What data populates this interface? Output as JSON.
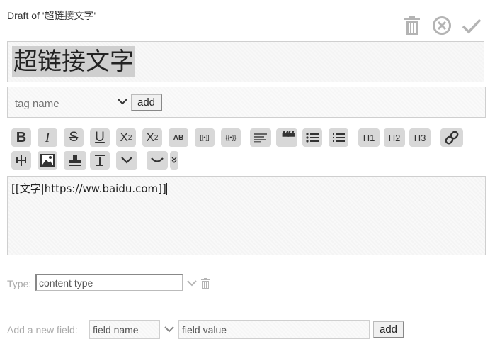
{
  "header": {
    "draft_title": "Draft of '超链接文字'",
    "actions": [
      {
        "name": "delete",
        "icon": "trash-icon"
      },
      {
        "name": "cancel",
        "icon": "close-circle-icon"
      },
      {
        "name": "save",
        "icon": "checkmark-icon"
      }
    ]
  },
  "title_field": {
    "value": "超链接文字"
  },
  "tags": {
    "placeholder": "tag name",
    "add_label": "add"
  },
  "toolbar": {
    "bold": "B",
    "italic": "I",
    "strike": "S",
    "underline": "U",
    "superscript": "X",
    "superscript_sup": "2",
    "subscript": "X",
    "subscript_sub": "2",
    "smallcaps": "AB",
    "link_wiki": "[[•]]",
    "transclude": "{{•}}",
    "quote": "❝❝",
    "h1": "H1",
    "h2": "H2",
    "h3": "H3"
  },
  "editor": {
    "text": "[[文字|https://ww.baidu.com]]"
  },
  "type": {
    "label": "Type:",
    "value": "content type"
  },
  "new_field": {
    "label": "Add a new field:",
    "name_placeholder": "field name",
    "value_placeholder": "field value",
    "add_label": "add"
  },
  "colors": {
    "button_bg": "#d8d8d8",
    "icon_gray": "#b4b4b4",
    "title_highlight": "#cfcfcf"
  }
}
